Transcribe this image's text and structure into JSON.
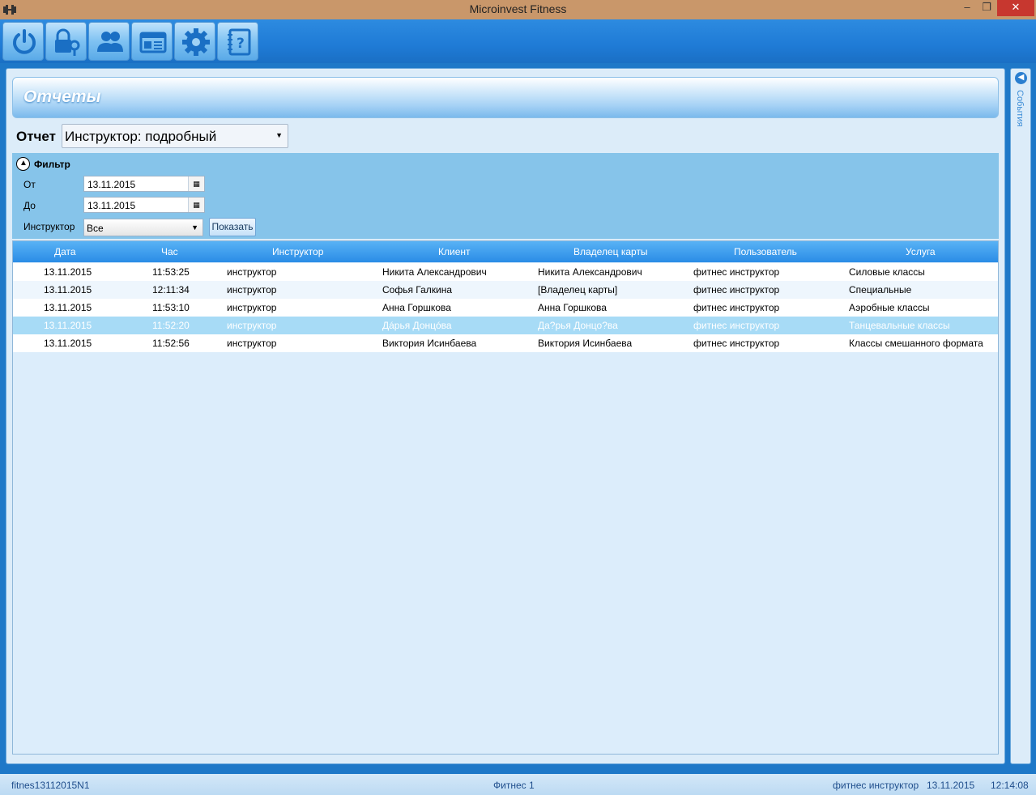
{
  "window": {
    "title": "Microinvest Fitness",
    "minimize": "‒",
    "maximize": "❐",
    "close": "✕"
  },
  "toolbar": {
    "buttons": [
      {
        "icon": "power-icon"
      },
      {
        "icon": "lock-key-icon"
      },
      {
        "icon": "users-icon"
      },
      {
        "icon": "cards-icon"
      },
      {
        "icon": "gear-icon"
      },
      {
        "icon": "help-book-icon"
      }
    ]
  },
  "page": {
    "title": "Отчеты"
  },
  "report": {
    "label": "Отчет",
    "selected": "Инструктор: подробный"
  },
  "filter": {
    "title": "Фильтр",
    "from_label": "От",
    "from_value": "13.11.2015",
    "to_label": "До",
    "to_value": "13.11.2015",
    "instructor_label": "Инструктор",
    "instructor_value": "Все",
    "show_button": "Показать"
  },
  "grid": {
    "columns": [
      "Дата",
      "Час",
      "Инструктор",
      "Клиент",
      "Владелец карты",
      "Пользователь",
      "Услуга"
    ],
    "rows": [
      [
        "13.11.2015",
        "11:53:25",
        "инструктор",
        "Никита Александрович",
        "Никита Александрович",
        "фитнес инструктор",
        "Силовые классы"
      ],
      [
        "13.11.2015",
        "12:11:34",
        "инструктор",
        "Софья Галкина",
        "[Владелец карты]",
        "фитнес инструктор",
        "Специальные"
      ],
      [
        "13.11.2015",
        "11:53:10",
        "инструктор",
        "Анна Горшкова",
        "Анна Горшкова",
        "фитнес инструктор",
        "Аэробные классы"
      ],
      [
        "13.11.2015",
        "11:52:20",
        "инструктор",
        "Дáрья Донцóва",
        "Да?рья Донцо?ва",
        "фитнес инструктор",
        "Танцевальные классы"
      ],
      [
        "13.11.2015",
        "11:52:56",
        "инструктор",
        "Виктория Исинбаева",
        "Виктория Исинбаева",
        "фитнес инструктор",
        "Классы смешанного формата"
      ]
    ],
    "selected_row": 3
  },
  "side_panel": {
    "label": "События"
  },
  "status": {
    "database": "fitnes13112015N1",
    "object": "Фитнес 1",
    "user": "фитнес инструктор",
    "date": "13.11.2015",
    "time": "12:14:08"
  }
}
